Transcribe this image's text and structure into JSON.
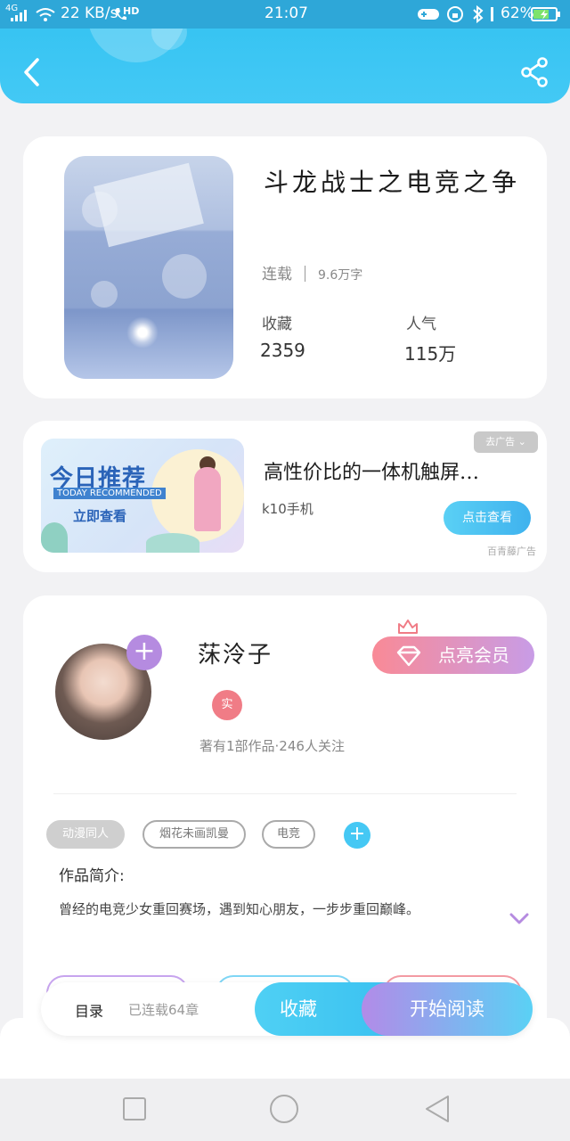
{
  "status_bar": {
    "network": "4G",
    "speed": "22 KB/s",
    "hd": "HD",
    "time": "21:07",
    "battery": "62%"
  },
  "book": {
    "title": "斗龙战士之电竞之争",
    "status": "连载",
    "word_count": "9.6万字",
    "collect_label": "收藏",
    "collect_value": "2359",
    "popularity_label": "人气",
    "popularity_value": "115万"
  },
  "ad": {
    "banner_title": "今日推荐",
    "banner_subtitle": "TODAY RECOMMENDED",
    "banner_cta": "立即查看",
    "close_label": "去广告",
    "title": "高性价比的一体机触屏…",
    "subtitle": "k10手机",
    "button": "点击查看",
    "source": "百青藤广告"
  },
  "author": {
    "name": "莯泠子",
    "badge": "实",
    "stats": "著有1部作品·246人关注",
    "vip_button": "点亮会员",
    "tags": [
      "动漫同人",
      "烟花未画凯曼",
      "电竞"
    ],
    "intro_label": "作品简介:",
    "intro_text": "曾经的电竞少女重回赛场，遇到知心朋友，一步步重回巅峰。"
  },
  "action_bar": {
    "catalog": "目录",
    "chapters": "已连载64章",
    "collect": "收藏",
    "read": "开始阅读"
  },
  "icons": {
    "back": "chevron-left-icon",
    "share": "share-icon",
    "expand": "chevron-down-icon",
    "crown": "crown-icon",
    "diamond": "diamond-icon"
  },
  "colors": {
    "header": "#3ec6f4",
    "accent_blue": "#45c8f4",
    "accent_purple": "#b58be0",
    "vip_pink": "#f98a96"
  }
}
